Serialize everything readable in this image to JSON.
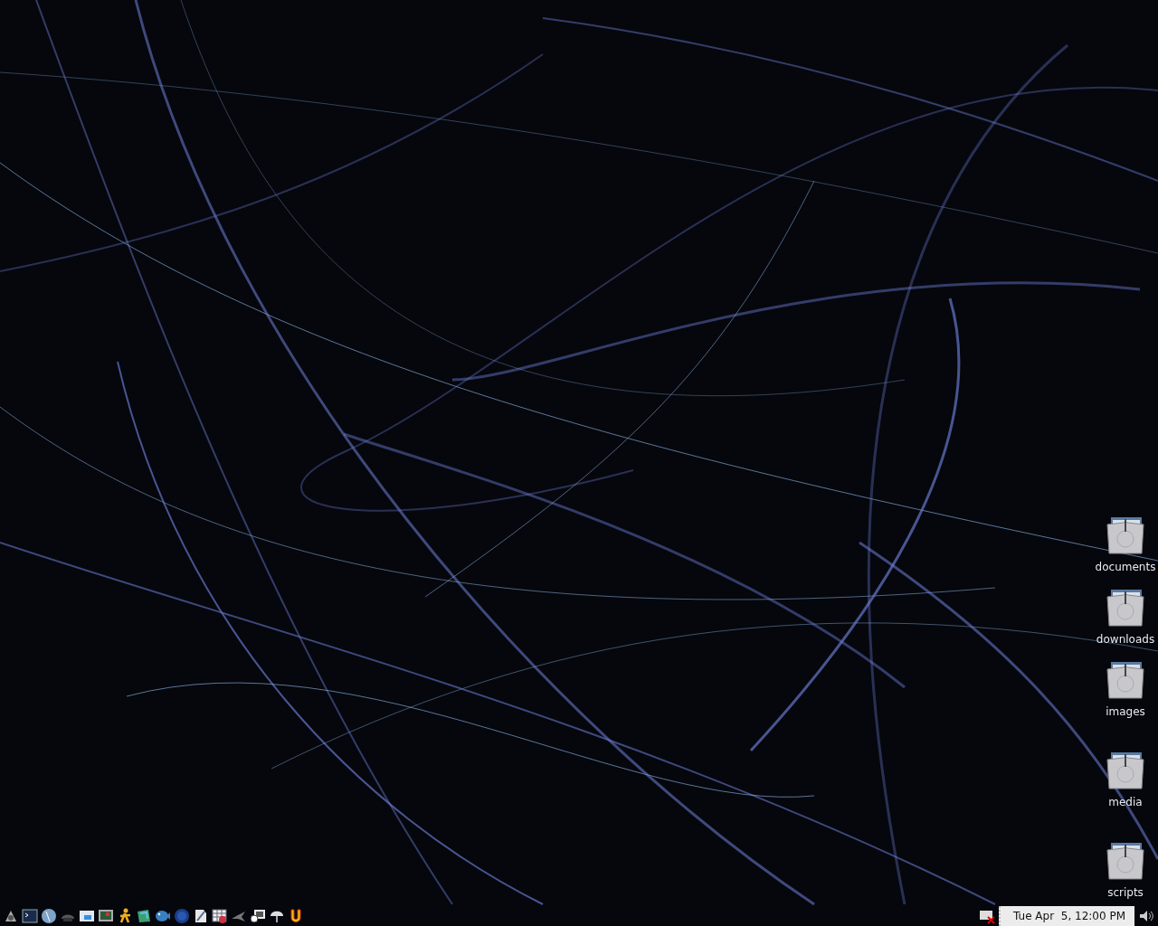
{
  "desktop_icons": [
    {
      "label": "documents"
    },
    {
      "label": "downloads"
    },
    {
      "label": "images"
    },
    {
      "label": "media"
    },
    {
      "label": "scripts"
    }
  ],
  "panel": {
    "clock": "Tue Apr  5, 12:00 PM"
  }
}
